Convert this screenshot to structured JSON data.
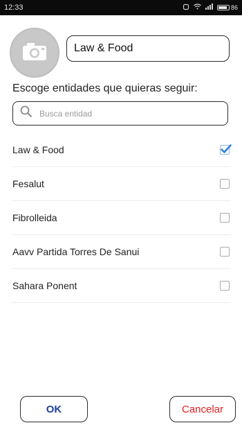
{
  "status_bar": {
    "time": "12:33",
    "battery_label": "86",
    "battery_level": 0.86
  },
  "avatar": {
    "icon": "camera-icon"
  },
  "name_field": {
    "value": "Law & Food"
  },
  "section_title": "Escoge entidades que quieras seguir:",
  "search": {
    "placeholder": "Busca entidad",
    "icon": "search-icon"
  },
  "entities": [
    {
      "label": "Law & Food",
      "checked": true
    },
    {
      "label": "Fesalut",
      "checked": false
    },
    {
      "label": "Fibrolleida",
      "checked": false
    },
    {
      "label": "Aavv Partida Torres De Sanui",
      "checked": false
    },
    {
      "label": "Sahara Ponent",
      "checked": false
    }
  ],
  "buttons": {
    "ok_label": "OK",
    "cancel_label": "Cancelar"
  },
  "colors": {
    "ok_text": "#1a3f9e",
    "cancel_text": "#e02020",
    "check_accent": "#2e7fd6",
    "avatar_bg": "#c8c8c8"
  }
}
